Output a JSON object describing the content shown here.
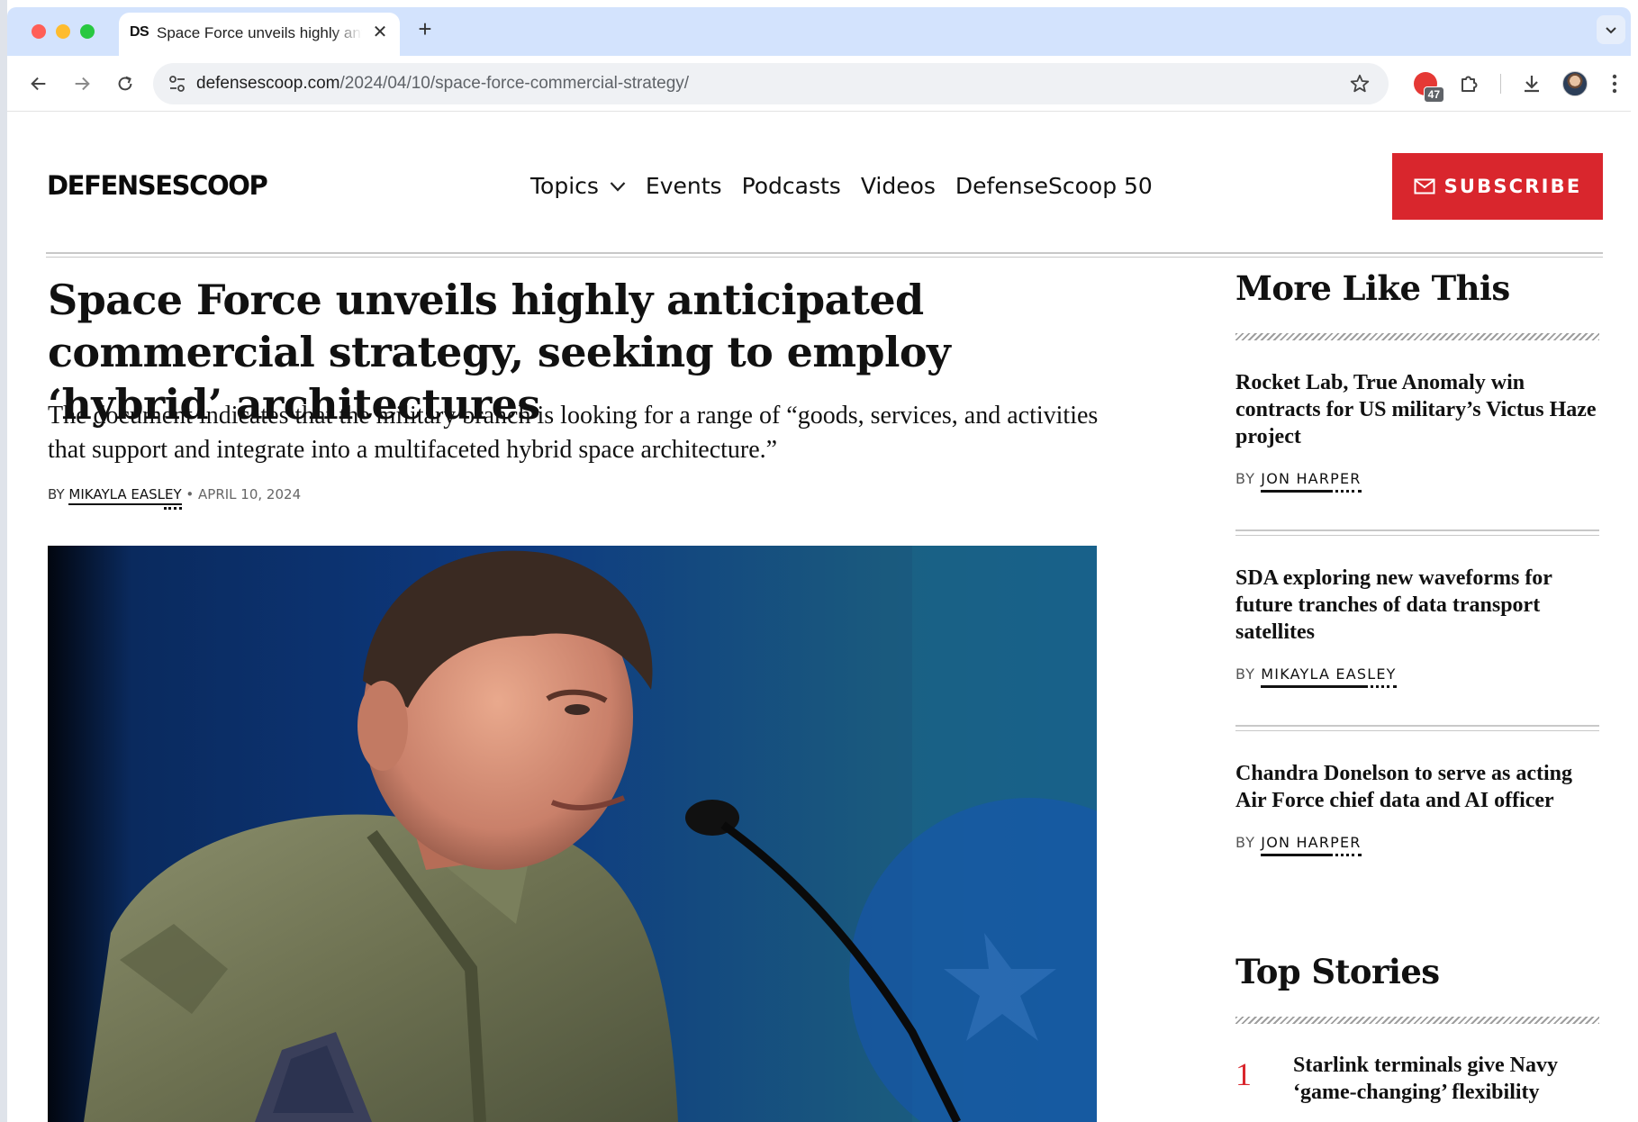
{
  "browser": {
    "tab_favicon": "DS",
    "tab_title": "Space Force unveils highly anticipated commercial strategy",
    "url_host": "defensescoop.com",
    "url_path": "/2024/04/10/space-force-commercial-strategy/",
    "extension_badge": "47"
  },
  "site": {
    "logo": "DEFENSESCOOP",
    "nav": [
      "Topics",
      "Events",
      "Podcasts",
      "Videos",
      "DefenseScoop 50"
    ],
    "subscribe_label": "SUBSCRIBE",
    "brand_color": "#d9262d"
  },
  "article": {
    "headline": "Space Force unveils highly anticipated commercial strategy, seeking to employ ‘hybrid’ architectures",
    "dek": "The document indicates that the military branch is looking for a range of “goods, services, and activities that support and integrate into a multifaceted hybrid space architecture.”",
    "byline_prefix": "BY",
    "author": "MIKAYLA EASLEY",
    "separator": "•",
    "date": "APRIL 10, 2024"
  },
  "sidebar": {
    "more_heading": "More Like This",
    "byline_prefix": "BY",
    "stories": [
      {
        "title": "Rocket Lab, True Anomaly win contracts for US military’s Victus Haze project",
        "author": "JON HARPER"
      },
      {
        "title": "SDA exploring new waveforms for future tranches of data transport satellites",
        "author": "MIKAYLA EASLEY"
      },
      {
        "title": "Chandra Donelson to serve as acting Air Force chief data and AI officer",
        "author": "JON HARPER"
      }
    ],
    "top_heading": "Top Stories",
    "top_stories": [
      {
        "rank": "1",
        "title": "Starlink terminals give Navy ‘game-changing’ flexibility"
      }
    ]
  }
}
